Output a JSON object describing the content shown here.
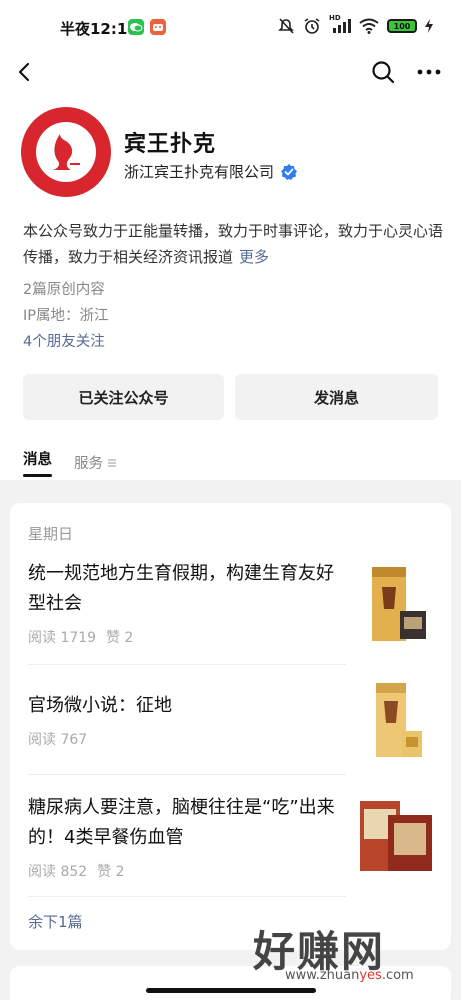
{
  "status_bar": {
    "time": "半夜12:14",
    "network": "HD",
    "battery": "100"
  },
  "profile": {
    "name": "宾王扑克",
    "company": "浙江宾王扑克有限公司",
    "description": "本公众号致力于正能量转播，致力于时事评论，致力于心灵心语传播，致力于相关经济资讯报道",
    "more": "更多",
    "original_count": "2篇原创内容",
    "ip_location": "IP属地：浙江",
    "friends_following": "4个朋友关注"
  },
  "actions": {
    "followed_label": "已关注公众号",
    "message_label": "发消息"
  },
  "tabs": {
    "messages": "消息",
    "services": "服务"
  },
  "feed": {
    "day": "星期日",
    "articles": [
      {
        "title": "统一规范地方生育假期，构建生育友好型社会",
        "reads": "阅读 1719",
        "likes": "赞 2"
      },
      {
        "title": "官场微小说：征地",
        "reads": "阅读 767",
        "likes": ""
      },
      {
        "title": "糖尿病人要注意，脑梗往往是“吃”出来的！4类早餐伤血管",
        "reads": "阅读 852",
        "likes": "赞 2"
      }
    ],
    "remaining": "余下1篇"
  },
  "watermark": {
    "text": "好赚网",
    "url_prefix": "www.zhuan",
    "url_mid": "yes",
    "url_suffix": ".com"
  },
  "icons": [
    "back-icon",
    "search-icon",
    "more-icon",
    "verified-icon",
    "mute-icon",
    "alarm-icon",
    "signal-icon",
    "wifi-icon",
    "battery-icon",
    "menu-lines-icon"
  ],
  "colors": {
    "link": "#576b95",
    "verified": "#2f7ef0",
    "battery": "#3bc53b",
    "feed_bg": "#f2f2f2"
  }
}
